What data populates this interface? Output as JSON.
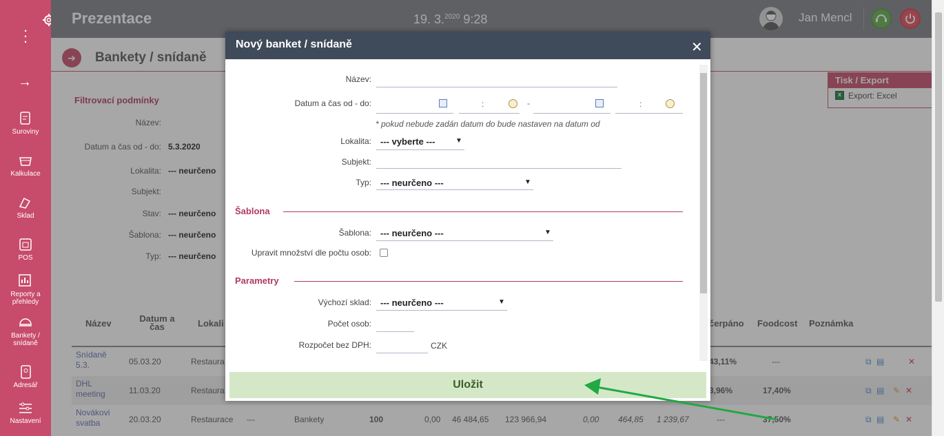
{
  "app": {
    "title": "Prezentace",
    "date": "19. 3.",
    "year": "2020",
    "time": "9:28",
    "user": "Jan Mencl"
  },
  "sidebar": {
    "items": [
      {
        "label": "Suroviny"
      },
      {
        "label": "Kalkulace"
      },
      {
        "label": "Sklad"
      },
      {
        "label": "POS"
      },
      {
        "label": "Reporty a přehledy"
      },
      {
        "label": "Bankety / snídaně"
      },
      {
        "label": "Adresář"
      },
      {
        "label": "Nastavení"
      }
    ]
  },
  "page": {
    "title": "Bankety / snídaně",
    "filter_title": "Filtrovací podmínky",
    "filters": [
      {
        "label": "Název:",
        "value": ""
      },
      {
        "label": "Datum a čas od - do:",
        "value": "5.3.2020"
      },
      {
        "label": "Lokalita:",
        "value": "--- neurčeno"
      },
      {
        "label": "Subjekt:",
        "value": ""
      },
      {
        "label": "Stav:",
        "value": "--- neurčeno"
      },
      {
        "label": "Šablona:",
        "value": "--- neurčeno"
      },
      {
        "label": "Typ:",
        "value": "--- neurčeno"
      }
    ],
    "export": {
      "title": "Tisk / Export",
      "excel": "Export: Excel"
    },
    "table": {
      "headers": {
        "nazev": "Název",
        "datum": "Datum a čas",
        "lokalita": "Lokali",
        "cerpano": "čerpáno",
        "foodcost": "Foodcost",
        "poznamka": "Poznámka"
      },
      "rows": [
        {
          "name": "Snídaně 5.3.",
          "date": "05.03.20",
          "loc": "Restaura",
          "cerpano": "43,11%",
          "foodcost": "---"
        },
        {
          "name": "DHL meeting",
          "date": "11.03.20",
          "loc": "Restaura",
          "cerpano": "3,96%",
          "foodcost": "17,40%"
        },
        {
          "name": "Novákovi svatba",
          "date": "20.03.20",
          "loc": "Restaurace",
          "subj": "---",
          "type": "Bankety",
          "persons": "100",
          "v1": "0,00",
          "v2": "46 484,65",
          "v3": "123 966,94",
          "v4": "0,00",
          "v5": "464,85",
          "v6": "1 239,67",
          "cerpano": "---",
          "foodcost": "37,50%"
        }
      ]
    }
  },
  "modal": {
    "title": "Nový banket / snídaně",
    "close": "✕",
    "labels": {
      "nazev": "Název:",
      "datum": "Datum a čas od - do:",
      "lokalita": "Lokalita:",
      "subjekt": "Subjekt:",
      "typ": "Typ:",
      "sablona": "Šablona:",
      "upravit": "Upravit množství dle počtu osob:",
      "sklad": "Výchozí sklad:",
      "osob": "Počet osob:",
      "rozpocet": "Rozpočet bez DPH:"
    },
    "note": "* pokud nebude zadán datum do bude nastaven na datum od",
    "values": {
      "lokalita": "--- vyberte ---",
      "typ": "--- neurčeno ---",
      "sablona": "--- neurčeno ---",
      "sklad": "--- neurčeno ---",
      "currency": "CZK",
      "dash": "-",
      "colon": ":"
    },
    "sections": {
      "sablona": "Šablona",
      "parametry": "Parametry"
    },
    "save": "Uložit"
  },
  "colors": {
    "accent": "#c74b6a",
    "topbar": "#7b7e86",
    "modal_header": "#3f4a5a",
    "save_bg": "#d4e8c8",
    "arrow": "#22a843"
  }
}
